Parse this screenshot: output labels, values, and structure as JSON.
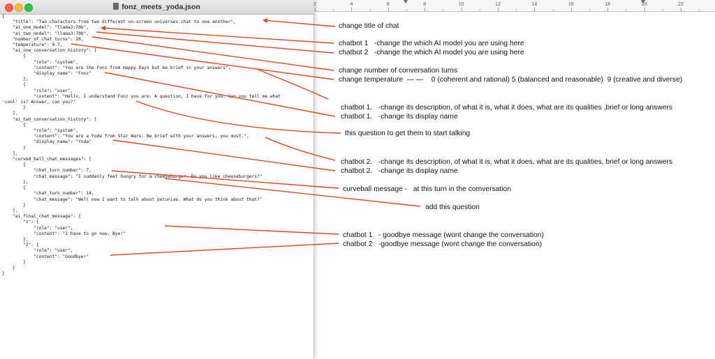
{
  "window": {
    "title": "fonz_meets_yoda.json"
  },
  "ruler": {
    "labels": [
      "2",
      "4",
      "6",
      "8",
      "10",
      "12",
      "14",
      "16",
      "18",
      "20",
      "22"
    ]
  },
  "code_lines": [
    "{",
    "    \"title\": \"Two characters from two different on-screen universes chat to one another\",",
    "    \"ai_one_model\": \"llama3:70b\",",
    "    \"ai_two_model\": \"llama3:70b\",",
    "    \"number_of_chat_turns\": 20,",
    "    \"temperature\": 0.7,",
    "    \"ai_one_conversation_history\": [",
    "        {",
    "            \"role\": \"system\",",
    "            \"content\": \"You are the Fonz from Happy Days but be brief in your answers\",",
    "            \"display_name\": \"Fonz\"",
    "        },",
    "        {",
    "            \"role\": \"user\",",
    "            \"content\": \"Hello, I understand Fonz you are. A question, I have for you: Can you tell me what",
    "'cool' is? Answer, can you?\"",
    "        }",
    "    ],",
    "    \"ai_two_conversation_history\": [",
    "        {",
    "            \"role\": \"system\",",
    "            \"content\": \"You are a Yoda from Star Wars. Be brief with your answers, you must.\",",
    "            \"display_name\": \"Yoda\"",
    "        }",
    "    ],",
    "    \"curved_ball_chat_messages\": [",
    "        {",
    "            \"chat_turn_number\": 7,",
    "            \"chat_message\": \"I suddenly feel hungry for a cheeseburger. Do you like cheeseburgers?\"",
    "        },",
    "        {",
    "            \"chat_turn_number\": 14,",
    "            \"chat_message\": \"Well now I want to talk about petunias. What do you think about that?\"",
    "        }",
    "    ],",
    "    \"ai_final_chat_message\": {",
    "        \"1\": {",
    "            \"role\": \"user\",",
    "            \"content\": \"I have to go now. Bye!\"",
    "        },",
    "        \"2\": {",
    "            \"role\": \"user\",",
    "            \"content\": \"Goodbye!\"",
    "        }",
    "    }",
    "}"
  ],
  "annotations": [
    "change title of chat",
    "chatbot 1   -change the which AI model you are using here",
    "chatbot 2   -change the which AI model you are using here",
    "change number of conversation turns",
    "change temperature  — —    0 (coherent and rational) 5 (balanced and reasonable)  9 (creative and diverse)",
    "chatbot 1.   -change its description, of what it is, what it does, what are its qualities ,brief or long answers",
    "chatbot 1.   -change its display name",
    "this question to get them to start talking",
    "chatbot 2.   -change its description, of what it is, what it does, what are its qualities, brief or long answers",
    "chatbot 2.   -change its display name",
    "curveball message -   at this turn in the comversation",
    "add this question",
    "chatbot 1   - goodbye message (wont change the conversation)",
    "chatbot 2   -goodbye message (wont change the conversation)"
  ],
  "colors": {
    "arrow": "#e2461e"
  }
}
